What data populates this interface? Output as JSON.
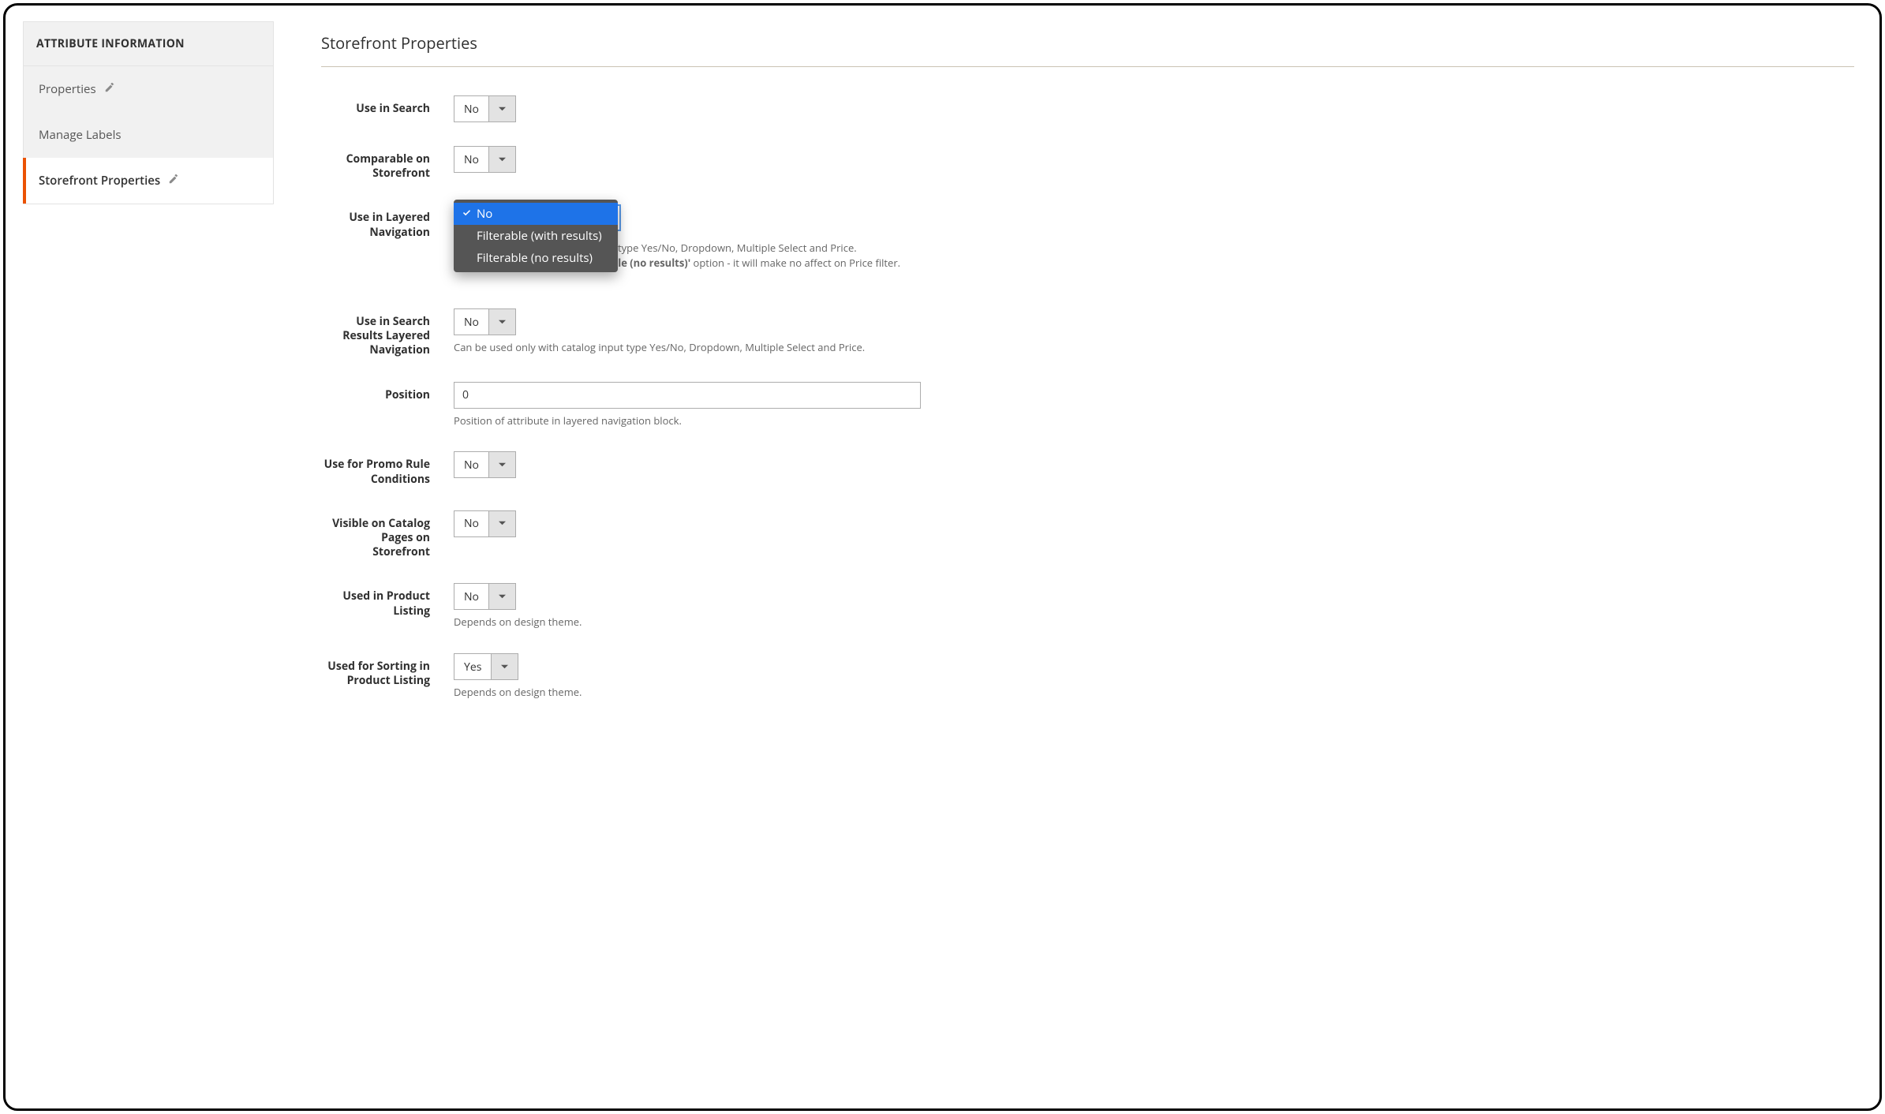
{
  "sidebar": {
    "title": "ATTRIBUTE INFORMATION",
    "items": [
      {
        "label": "Properties",
        "editable": true,
        "active": false
      },
      {
        "label": "Manage Labels",
        "editable": false,
        "active": false
      },
      {
        "label": "Storefront Properties",
        "editable": true,
        "active": true
      }
    ]
  },
  "section_title": "Storefront Properties",
  "fields": {
    "use_in_search": {
      "label": "Use in Search",
      "value": "No"
    },
    "comparable": {
      "label": "Comparable on Storefront",
      "value": "No"
    },
    "layered_nav": {
      "label": "Use in Layered Navigation",
      "value": "No",
      "options": [
        "No",
        "Filterable (with results)",
        "Filterable (no results)"
      ],
      "hint_visible_tail_a": "t type Yes/No, Dropdown, Multiple Select and Price.",
      "hint_visible_tail_b_prefix": "ble (no results)'",
      "hint_visible_tail_b_suffix": " option - it will make no affect on Price filter."
    },
    "search_results_layered": {
      "label": "Use in Search Results Layered Navigation",
      "value": "No",
      "hint": "Can be used only with catalog input type Yes/No, Dropdown, Multiple Select and Price."
    },
    "position": {
      "label": "Position",
      "value": "0",
      "hint": "Position of attribute in layered navigation block."
    },
    "promo_rule": {
      "label": "Use for Promo Rule Conditions",
      "value": "No"
    },
    "visible_catalog": {
      "label": "Visible on Catalog Pages on Storefront",
      "value": "No"
    },
    "product_listing": {
      "label": "Used in Product Listing",
      "value": "No",
      "hint": "Depends on design theme."
    },
    "sorting": {
      "label": "Used for Sorting in Product Listing",
      "value": "Yes",
      "hint": "Depends on design theme."
    }
  }
}
